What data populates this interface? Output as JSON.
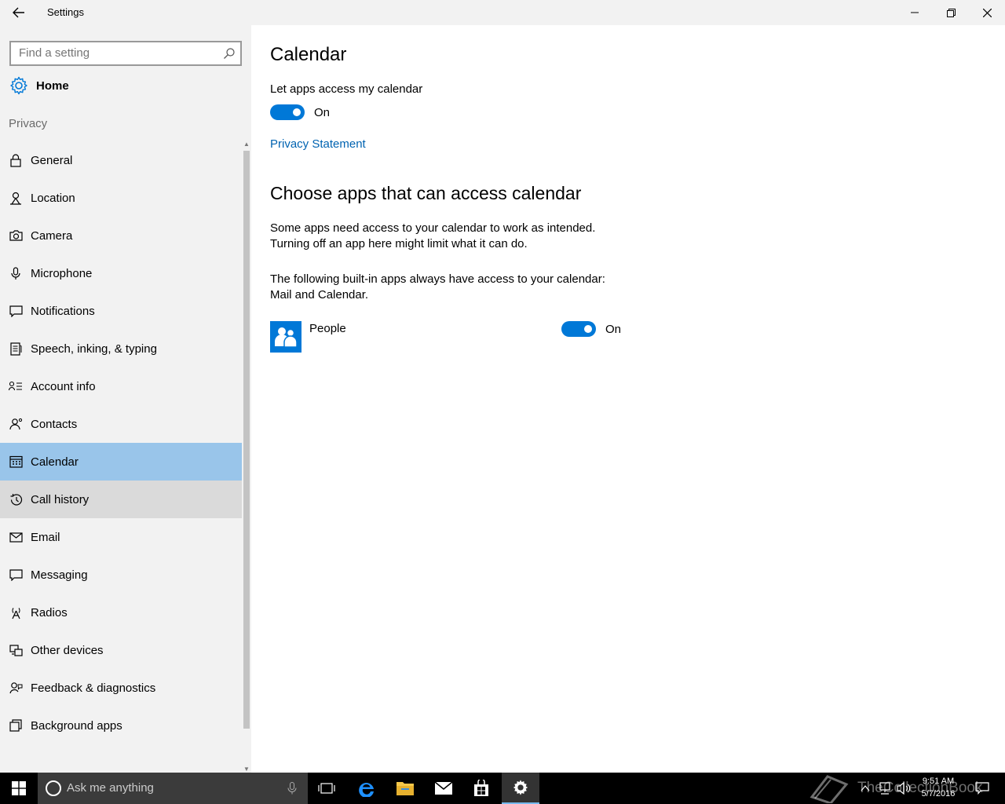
{
  "window": {
    "title": "Settings"
  },
  "sidebar": {
    "search_placeholder": "Find a setting",
    "home_label": "Home",
    "section_label": "Privacy",
    "items": [
      {
        "label": "General",
        "icon": "lock-icon"
      },
      {
        "label": "Location",
        "icon": "location-icon"
      },
      {
        "label": "Camera",
        "icon": "camera-icon"
      },
      {
        "label": "Microphone",
        "icon": "microphone-icon"
      },
      {
        "label": "Notifications",
        "icon": "notifications-icon"
      },
      {
        "label": "Speech, inking, & typing",
        "icon": "speech-icon"
      },
      {
        "label": "Account info",
        "icon": "account-info-icon"
      },
      {
        "label": "Contacts",
        "icon": "contacts-icon"
      },
      {
        "label": "Calendar",
        "icon": "calendar-icon",
        "selected": true
      },
      {
        "label": "Call history",
        "icon": "call-history-icon",
        "hover": true
      },
      {
        "label": "Email",
        "icon": "email-icon"
      },
      {
        "label": "Messaging",
        "icon": "messaging-icon"
      },
      {
        "label": "Radios",
        "icon": "radios-icon"
      },
      {
        "label": "Other devices",
        "icon": "other-devices-icon"
      },
      {
        "label": "Feedback & diagnostics",
        "icon": "feedback-icon"
      },
      {
        "label": "Background apps",
        "icon": "background-apps-icon"
      }
    ]
  },
  "main": {
    "title": "Calendar",
    "access_label": "Let apps access my calendar",
    "access_toggle_state": "On",
    "privacy_link": "Privacy Statement",
    "apps_heading": "Choose apps that can access calendar",
    "description_line1": "Some apps need access to your calendar to work as intended.",
    "description_line2": "Turning off an app here might limit what it can do.",
    "builtin_line1": "The following built-in apps always have access to your calendar:",
    "builtin_line2": "Mail and Calendar.",
    "apps": [
      {
        "name": "People",
        "toggle_state": "On",
        "icon": "people-icon"
      }
    ]
  },
  "taskbar": {
    "search_placeholder": "Ask me anything",
    "time": "9:51 AM",
    "date": "5/7/2016",
    "watermark": "TheCollectionBook"
  },
  "colors": {
    "accent": "#0078d7",
    "selected_nav": "#99c5ea",
    "link": "#0063b1",
    "sidebar_bg": "#f2f2f2"
  }
}
